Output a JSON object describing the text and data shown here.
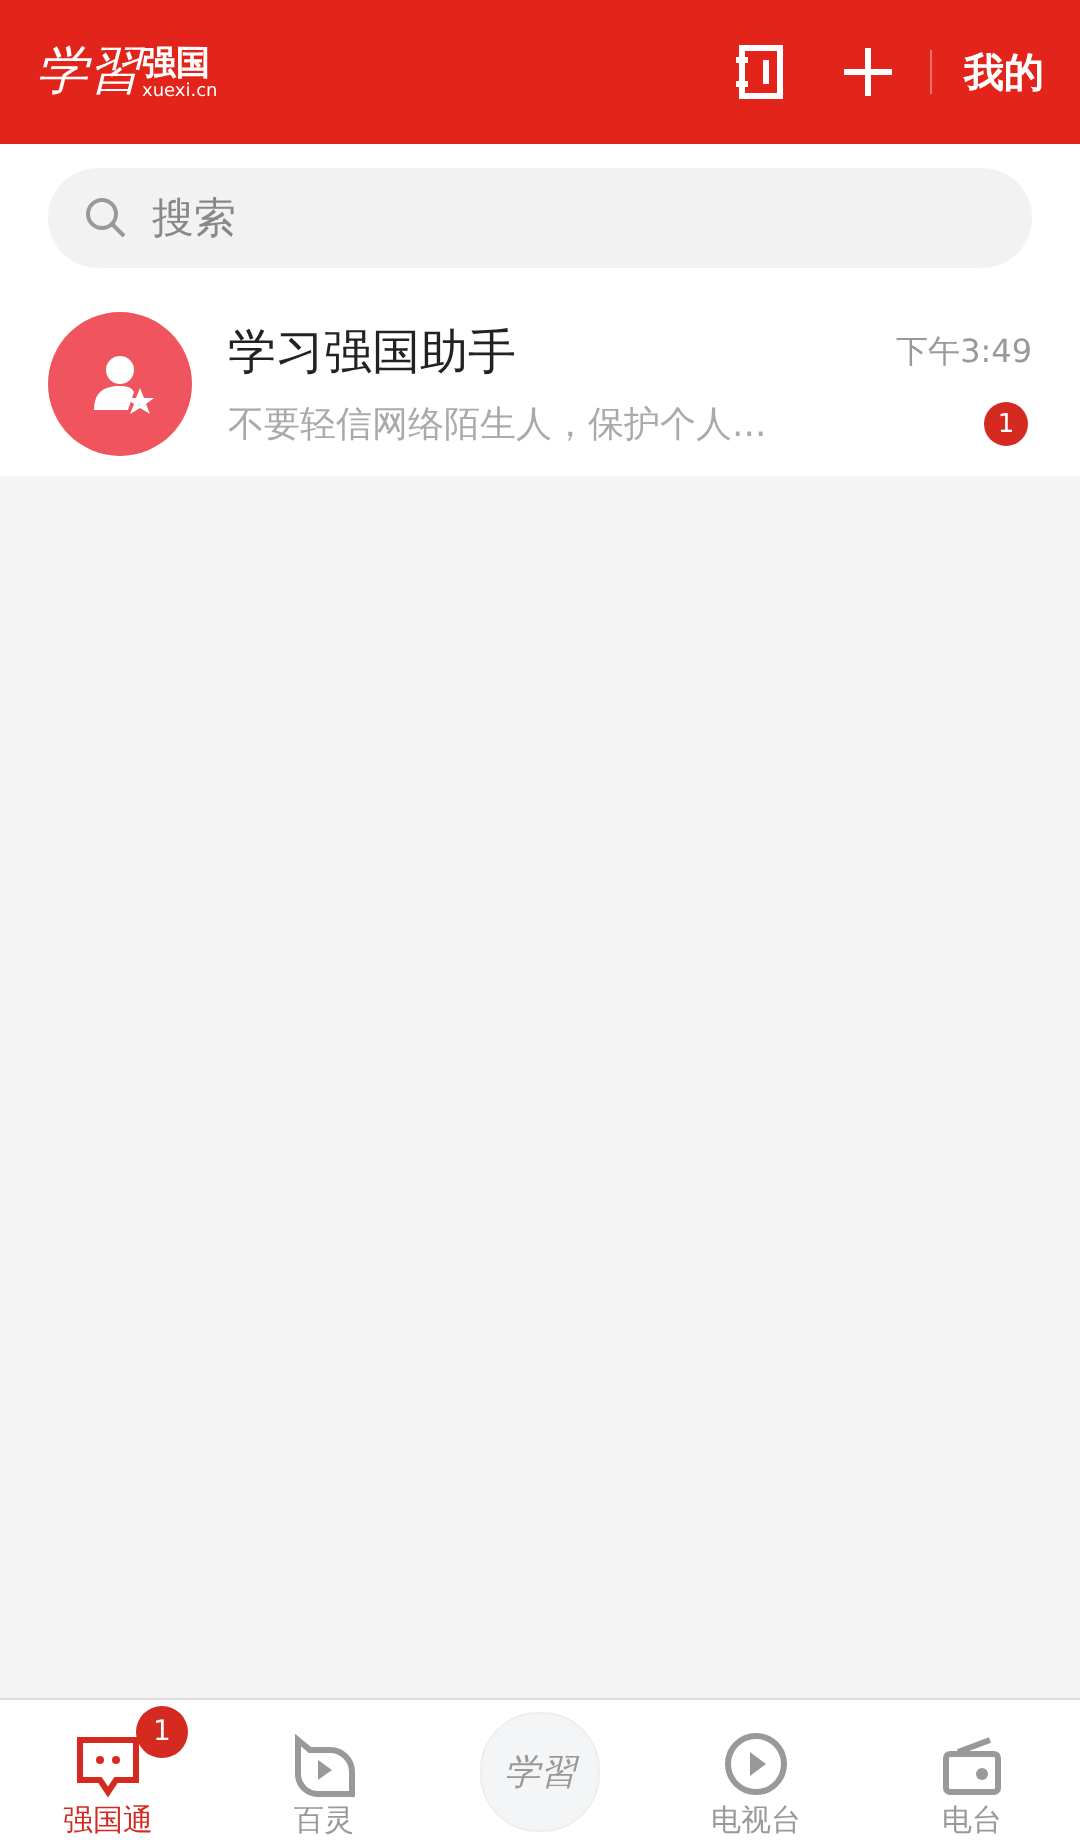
{
  "header": {
    "logo_script": "学習",
    "logo_name": "强国",
    "logo_domain": "xuexi.cn",
    "profile": "我的"
  },
  "search": {
    "placeholder": "搜索"
  },
  "conversations": [
    {
      "name": "学习强国助手",
      "preview": "不要轻信网络陌生人，保护个人...",
      "time": "下午3:49",
      "unread": "1"
    }
  ],
  "tabs": [
    {
      "kind": "chat",
      "label": "强国通",
      "selected": true,
      "badge": "1"
    },
    {
      "kind": "play-bubble",
      "label": "百灵",
      "selected": false
    },
    {
      "kind": "logo",
      "label": "学習",
      "selected": false
    },
    {
      "kind": "tv",
      "label": "电视台",
      "selected": false
    },
    {
      "kind": "radio",
      "label": "电台",
      "selected": false
    }
  ]
}
